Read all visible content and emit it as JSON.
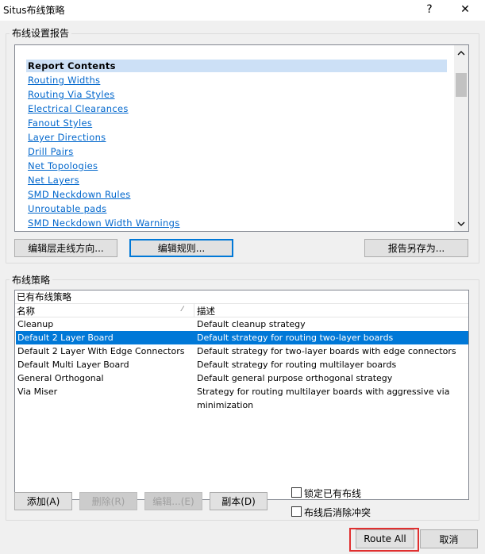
{
  "window": {
    "title": "Situs布线策略",
    "help_label": "?",
    "close_label": "✕"
  },
  "report_group": {
    "label": "布线设置报告",
    "header": "Report Contents",
    "links": [
      "Routing Widths",
      "Routing Via Styles",
      "Electrical Clearances",
      "Fanout Styles",
      "Layer Directions",
      "Drill Pairs",
      "Net Topologies",
      "Net Layers",
      "SMD Neckdown Rules",
      "Unroutable pads",
      "SMD Neckdown Width Warnings"
    ],
    "buttons": {
      "edit_layer_dir": "编辑层走线方向...",
      "edit_rules": "编辑规则...",
      "save_report": "报告另存为..."
    }
  },
  "strategy_group": {
    "label": "布线策略",
    "list_title": "已有布线策略",
    "columns": {
      "name": "名称",
      "desc": "描述"
    },
    "rows": [
      {
        "name": "Cleanup",
        "desc": "Default cleanup strategy"
      },
      {
        "name": "Default 2 Layer Board",
        "desc": "Default strategy for routing two-layer boards"
      },
      {
        "name": "Default 2 Layer With Edge Connectors",
        "desc": "Default strategy for two-layer boards with edge connectors"
      },
      {
        "name": "Default Multi Layer Board",
        "desc": "Default strategy for routing multilayer boards"
      },
      {
        "name": "General Orthogonal",
        "desc": "Default general purpose orthogonal strategy"
      },
      {
        "name": "Via Miser",
        "desc": "Strategy for routing multilayer boards with aggressive via minimization"
      }
    ],
    "selected_row": 1,
    "buttons": {
      "add": "添加(A)",
      "remove": "删除(R)",
      "edit": "编辑...(E)",
      "copy": "副本(D)"
    },
    "checkboxes": {
      "lock": "锁定已有布线",
      "cleanup": "布线后消除冲突"
    }
  },
  "footer": {
    "route_all": "Route All",
    "cancel": "取消"
  },
  "colors": {
    "selection": "#0078d7",
    "link": "#0066cc",
    "highlight_box": "#e03030"
  }
}
